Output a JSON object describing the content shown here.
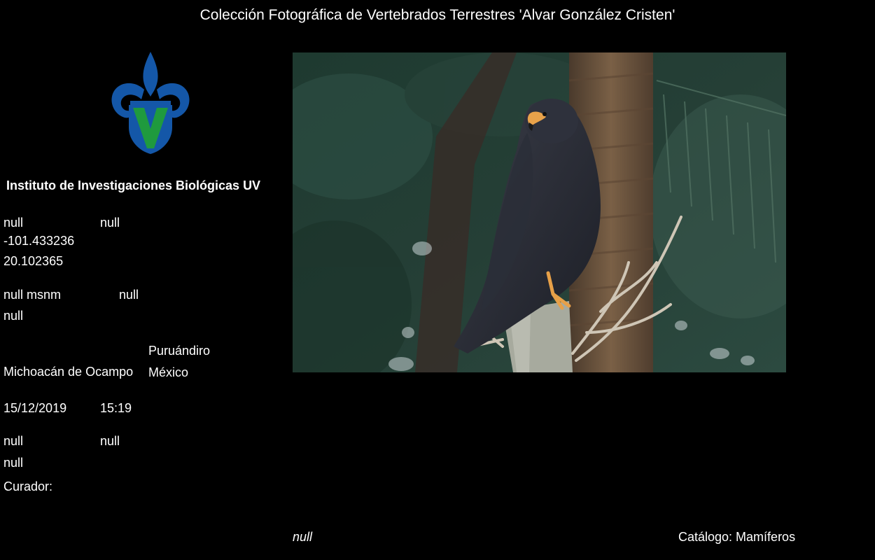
{
  "header": {
    "title": "Colección Fotográfica de Vertebrados Terrestres 'Alvar González Cristen'"
  },
  "brand": {
    "logo_icon": "fleur-de-lis-v-logo",
    "colors": {
      "logo_blue": "#1457a8",
      "logo_green": "#1f9a3e"
    },
    "institute": "Instituto de Investigaciones Biológicas UV"
  },
  "record": {
    "field_a": "null",
    "field_b": "null",
    "longitude": "-101.433236",
    "latitude": "20.102365",
    "altitude": "null msnm",
    "field_c": "null",
    "field_d": "null",
    "municipality": "Puruándiro",
    "state": "Michoacán de Ocampo",
    "country": "México",
    "date": "15/12/2019",
    "time": "15:19",
    "field_e": "null",
    "field_f": "null",
    "field_g": "null",
    "curator_label": "Curador:"
  },
  "photo": {
    "subject": "dark hawk perched on a dead tree stump"
  },
  "footer": {
    "caption": "null",
    "catalog": "Catálogo: Mamíferos"
  }
}
